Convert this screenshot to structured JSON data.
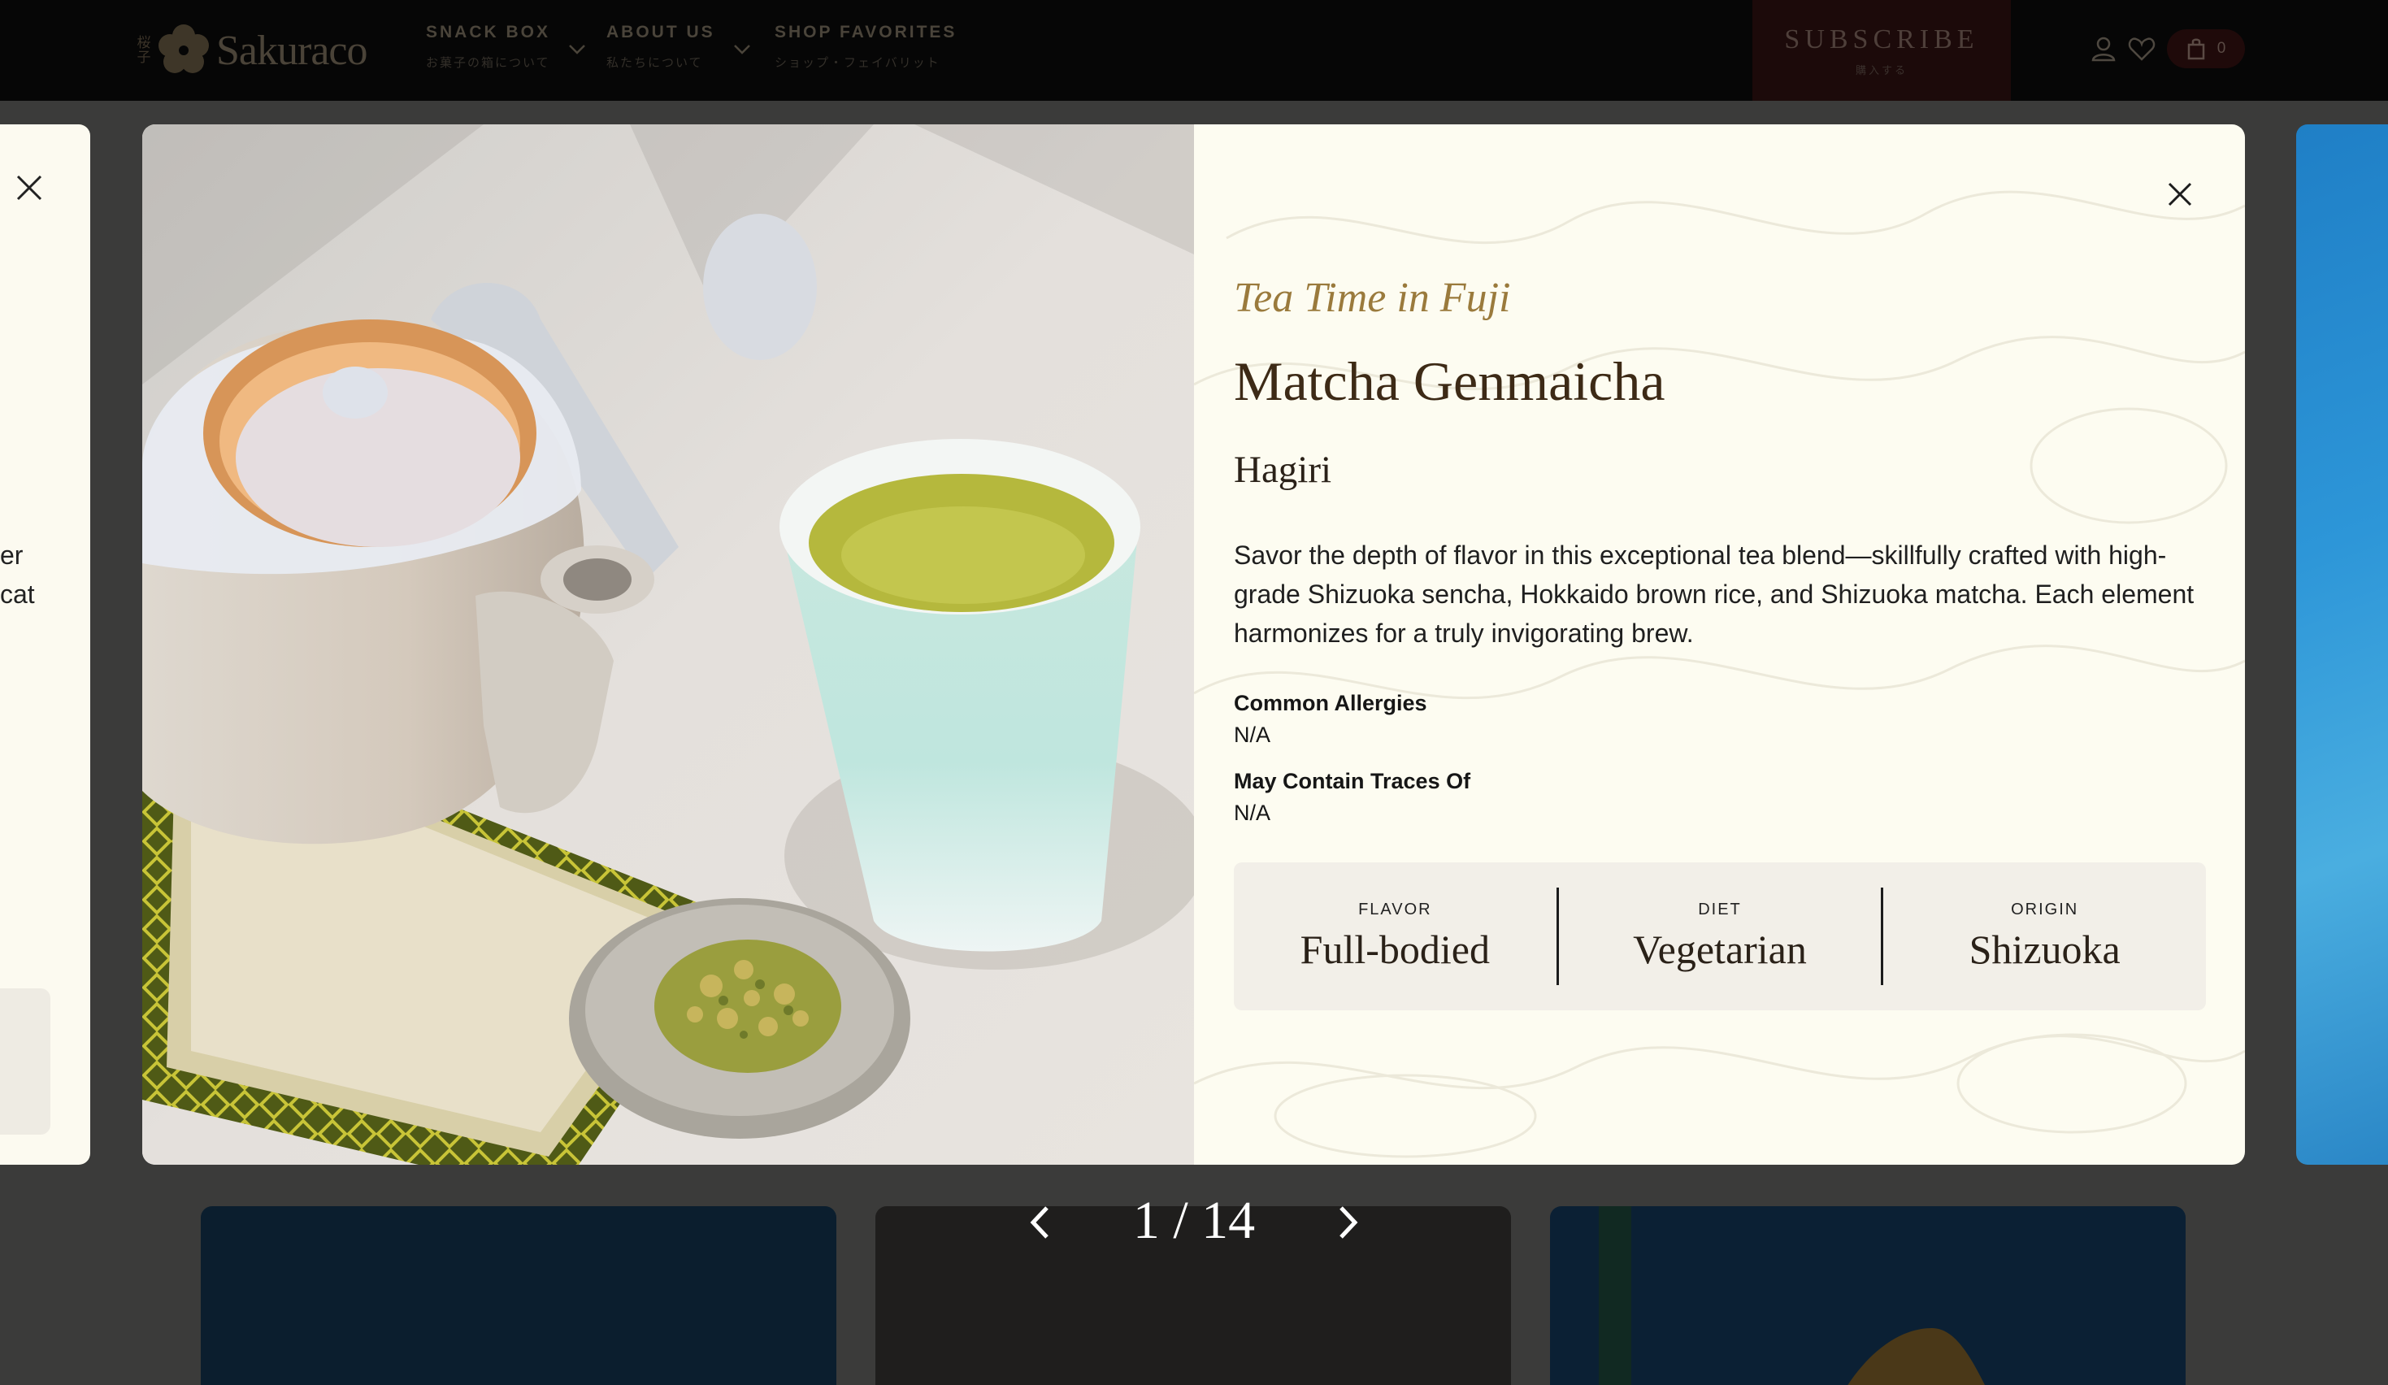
{
  "header": {
    "logo_text": "Sakuraco",
    "logo_kanji": "桜子",
    "nav": [
      {
        "label": "SNACK BOX",
        "sublabel": "お菓子の箱について"
      },
      {
        "label": "ABOUT US",
        "sublabel": "私たちについて"
      },
      {
        "label": "SHOP FAVORITES",
        "sublabel": "ショップ・フェイバリット"
      }
    ],
    "subscribe_label": "SUBSCRIBE",
    "subscribe_sublabel": "購入する",
    "cart_count": "0"
  },
  "side_panel_left": {
    "fragment_1": "er",
    "fragment_2": "cat"
  },
  "product": {
    "series": "Tea Time in Fuji",
    "name": "Matcha Genmaicha",
    "maker": "Hagiri",
    "description": "Savor the depth of flavor in this exceptional tea blend—skillfully crafted with high-grade Shizuoka sencha, Hokkaido brown rice, and Shizuoka matcha. Each element harmonizes for a truly invigorating brew.",
    "allergies_label": "Common Allergies",
    "allergies_value": "N/A",
    "traces_label": "May Contain Traces Of",
    "traces_value": "N/A",
    "attributes": [
      {
        "label": "FLAVOR",
        "value": "Full-bodied"
      },
      {
        "label": "DIET",
        "value": "Vegetarian"
      },
      {
        "label": "ORIGIN",
        "value": "Shizuoka"
      }
    ]
  },
  "pager": {
    "text": "1 / 14"
  },
  "icons": {
    "close": "close-icon",
    "prev": "chevron-left-icon",
    "next": "chevron-right-icon",
    "account": "user-icon",
    "wishlist": "heart-icon",
    "cart": "bag-icon"
  },
  "colors": {
    "modal_bg": "#fdfcf1",
    "series_gold": "#9a7a3c",
    "title_brown": "#3d2a16",
    "attribute_box": "#f2efe8",
    "header_bg": "#060606",
    "subscribe_bg": "#1c0a0a"
  }
}
